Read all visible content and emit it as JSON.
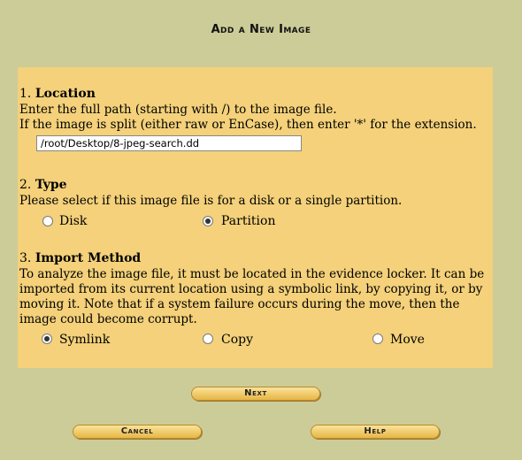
{
  "page": {
    "title": "Add a New Image"
  },
  "location": {
    "number": "1.",
    "title": "Location",
    "line1": "Enter the full path (starting with /) to the image file.",
    "line2": "If the image is split (either raw or EnCase), then enter '*' for the extension.",
    "path_value": "/root/Desktop/8-jpeg-search.dd"
  },
  "type": {
    "number": "2.",
    "title": "Type",
    "description": "Please select if this image file is for a disk or a single partition.",
    "options": [
      {
        "label": "Disk",
        "checked": false
      },
      {
        "label": "Partition",
        "checked": true
      }
    ]
  },
  "import": {
    "number": "3.",
    "title": "Import Method",
    "description": "To analyze the image file, it must be located in the evidence locker. It can be imported from its current location using a symbolic link, by copying it, or by moving it. Note that if a system failure occurs during the move, then the image could become corrupt.",
    "options": [
      {
        "label": "Symlink",
        "checked": true
      },
      {
        "label": "Copy",
        "checked": false
      },
      {
        "label": "Move",
        "checked": false
      }
    ]
  },
  "buttons": {
    "next": "Next",
    "cancel": "Cancel",
    "help": "Help"
  },
  "colors": {
    "background": "#cccc99",
    "panel": "#f4d17a",
    "button": "#f0c860"
  }
}
